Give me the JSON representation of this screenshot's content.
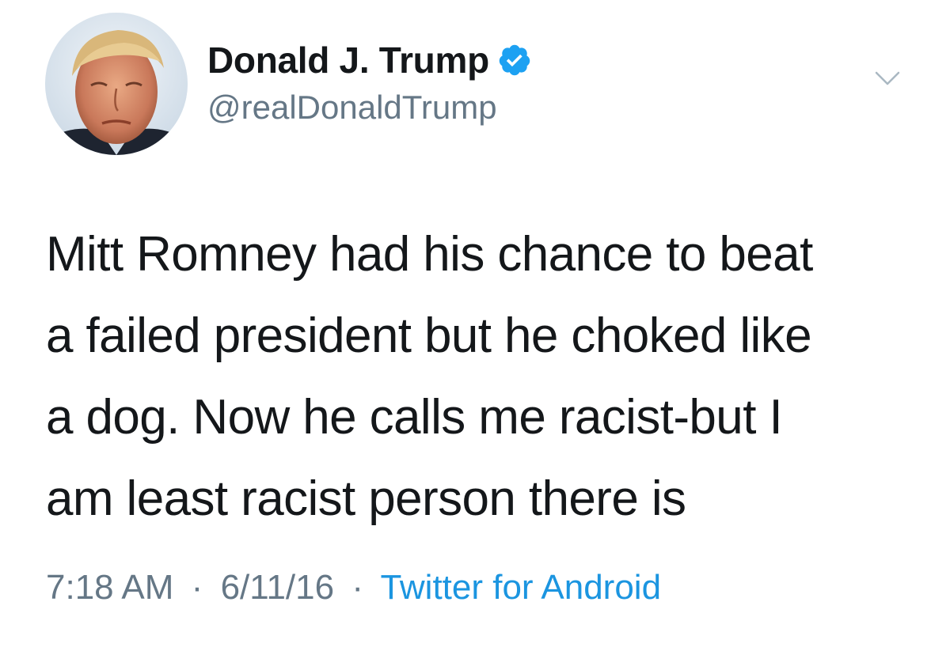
{
  "user": {
    "display_name": "Donald J. Trump",
    "handle": "@realDonaldTrump",
    "verified": true,
    "avatar_icon": "user-avatar"
  },
  "menu": {
    "icon": "chevron-down-icon"
  },
  "tweet": {
    "lines": [
      "Mitt Romney had his chance to beat",
      "a failed president but he choked like",
      "a dog. Now he calls me racist-but I",
      "am least racist person there is"
    ]
  },
  "meta": {
    "time": "7:18 AM",
    "separator": "·",
    "date": "6/11/16",
    "source": "Twitter for Android"
  },
  "colors": {
    "text": "#14171a",
    "secondary": "#657786",
    "link": "#1b95e0",
    "verified": "#1da1f2"
  }
}
